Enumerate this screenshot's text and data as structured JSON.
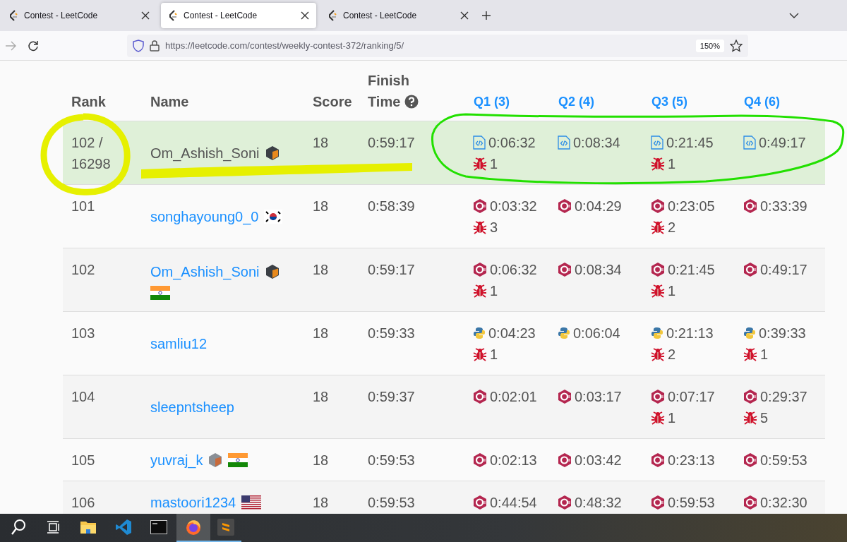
{
  "browser": {
    "tabs": [
      {
        "title": "Contest - LeetCode",
        "selected": false
      },
      {
        "title": "Contest - LeetCode",
        "selected": true
      },
      {
        "title": "Contest - LeetCode",
        "selected": false
      }
    ],
    "url": "https://leetcode.com/contest/weekly-contest-372/ranking/5/",
    "zoom": "150%"
  },
  "table": {
    "columns": {
      "rank": "Rank",
      "name": "Name",
      "score": "Score",
      "finish_1": "Finish",
      "finish_2": "Time",
      "questions": [
        "Q1 (3)",
        "Q2 (4)",
        "Q3 (5)",
        "Q4 (6)"
      ]
    },
    "rows": [
      {
        "kind": "self",
        "rank_1": "102 /",
        "rank_2": "16298",
        "name": "Om_Ashish_Soni",
        "badges": [
          {
            "kind": "guardian"
          }
        ],
        "flags": [],
        "score": "18",
        "finish": "0:59:17",
        "problems": [
          {
            "kind": "file",
            "time": "0:06:32",
            "bugs": "1"
          },
          {
            "kind": "file",
            "time": "0:08:34"
          },
          {
            "kind": "file",
            "time": "0:21:45",
            "bugs": "1"
          },
          {
            "kind": "file",
            "time": "0:49:17"
          }
        ]
      },
      {
        "kind": "user",
        "rank_1": "101",
        "name": "songhayoung0_0",
        "badges": [],
        "flags": [
          {
            "kind": "kr"
          }
        ],
        "score": "18",
        "finish": "0:58:39",
        "problems": [
          {
            "kind": "cpp",
            "time": "0:03:32",
            "bugs": "3"
          },
          {
            "kind": "cpp",
            "time": "0:04:29"
          },
          {
            "kind": "cpp",
            "time": "0:23:05",
            "bugs": "2"
          },
          {
            "kind": "cpp",
            "time": "0:33:39"
          }
        ]
      },
      {
        "kind": "user",
        "rank_1": "102",
        "name": "Om_Ashish_Soni",
        "badges": [
          {
            "kind": "guardian"
          }
        ],
        "flags": [
          {
            "kind": "in"
          }
        ],
        "score": "18",
        "finish": "0:59:17",
        "problems": [
          {
            "kind": "cpp",
            "time": "0:06:32",
            "bugs": "1"
          },
          {
            "kind": "cpp",
            "time": "0:08:34"
          },
          {
            "kind": "cpp",
            "time": "0:21:45",
            "bugs": "1"
          },
          {
            "kind": "cpp",
            "time": "0:49:17"
          }
        ]
      },
      {
        "kind": "user",
        "rank_1": "103",
        "name": "samliu12",
        "badges": [],
        "flags": [],
        "score": "18",
        "finish": "0:59:33",
        "problems": [
          {
            "kind": "python",
            "time": "0:04:23",
            "bugs": "1"
          },
          {
            "kind": "python",
            "time": "0:06:04"
          },
          {
            "kind": "python",
            "time": "0:21:13",
            "bugs": "2"
          },
          {
            "kind": "python",
            "time": "0:39:33",
            "bugs": "1"
          }
        ]
      },
      {
        "kind": "user",
        "rank_1": "104",
        "name": "sleepntsheep",
        "badges": [],
        "flags": [],
        "score": "18",
        "finish": "0:59:37",
        "problems": [
          {
            "kind": "cpp",
            "time": "0:02:01"
          },
          {
            "kind": "cpp",
            "time": "0:03:17"
          },
          {
            "kind": "cpp",
            "time": "0:07:17",
            "bugs": "1"
          },
          {
            "kind": "cpp",
            "time": "0:29:37",
            "bugs": "5"
          }
        ]
      },
      {
        "kind": "user",
        "rank_1": "105",
        "name": "yuvraj_k",
        "badges": [
          {
            "kind": "knight"
          }
        ],
        "flags": [
          {
            "kind": "in"
          }
        ],
        "score": "18",
        "finish": "0:59:53",
        "problems": [
          {
            "kind": "cpp",
            "time": "0:02:13"
          },
          {
            "kind": "cpp",
            "time": "0:03:42"
          },
          {
            "kind": "cpp",
            "time": "0:23:13"
          },
          {
            "kind": "cpp",
            "time": "0:59:53"
          }
        ]
      },
      {
        "kind": "user",
        "rank_1": "106",
        "name": "mastoori1234",
        "badges": [],
        "flags": [
          {
            "kind": "us"
          }
        ],
        "score": "18",
        "finish": "0:59:53",
        "problems": [
          {
            "kind": "cpp",
            "time": "0:44:54"
          },
          {
            "kind": "cpp",
            "time": "0:48:32"
          },
          {
            "kind": "cpp",
            "time": "0:59:53"
          },
          {
            "kind": "cpp",
            "time": "0:32:30"
          }
        ]
      }
    ]
  },
  "taskbar": {
    "items": [
      {
        "kind": "search",
        "selected": false,
        "running": false
      },
      {
        "kind": "taskview",
        "selected": false,
        "running": false
      },
      {
        "kind": "explorer",
        "selected": false,
        "running": false
      },
      {
        "kind": "vscode",
        "selected": false,
        "running": false
      },
      {
        "kind": "terminal",
        "selected": false,
        "running": false
      },
      {
        "kind": "firefox",
        "selected": true,
        "running": true
      },
      {
        "kind": "sublime",
        "selected": false,
        "running": true
      }
    ]
  }
}
